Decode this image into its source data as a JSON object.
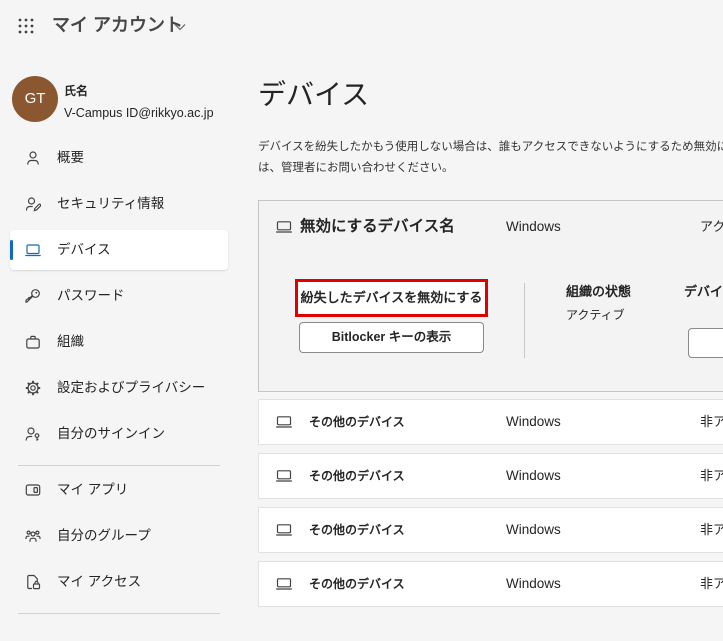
{
  "header": {
    "waffle_icon": "waffle-icon",
    "app_title": "マイ アカウント",
    "dropdown_icon": "chevron-down-icon"
  },
  "profile": {
    "initials": "GT",
    "name": "氏名",
    "account": "V-Campus ID@rikkyo.ac.jp"
  },
  "sidebar": {
    "items": [
      {
        "label": "概要",
        "icon": "person-icon",
        "selected": false
      },
      {
        "label": "セキュリティ情報",
        "icon": "person-edit-icon",
        "selected": false
      },
      {
        "label": "デバイス",
        "icon": "laptop-icon",
        "selected": true
      },
      {
        "label": "パスワード",
        "icon": "key-icon",
        "selected": false
      },
      {
        "label": "組織",
        "icon": "briefcase-icon",
        "selected": false
      },
      {
        "label": "設定およびプライバシー",
        "icon": "gear-icon",
        "selected": false
      },
      {
        "label": "自分のサインイン",
        "icon": "person-key-icon",
        "selected": false
      },
      {
        "label": "マイ アプリ",
        "icon": "apps-icon",
        "selected": false
      },
      {
        "label": "自分のグループ",
        "icon": "people-icon",
        "selected": false
      },
      {
        "label": "マイ アクセス",
        "icon": "document-lock-icon",
        "selected": false
      }
    ]
  },
  "main": {
    "title": "デバイス",
    "description": [
      "デバイスを紛失したかもう使用しない場合は、誰もアクセスできないようにするため無効に",
      "は、管理者にお問い合わせください。"
    ],
    "expanded_device": {
      "icon": "laptop-icon",
      "name": "無効にするデバイス名",
      "os": "Windows",
      "status": "アク",
      "disable_button": "紛失したデバイスを無効にする",
      "bitlocker_button": "Bitlocker キーの表示",
      "org_status_label": "組織の状態",
      "org_status_value": "アクティブ",
      "device_column_label": "デバイス"
    },
    "other_devices": [
      {
        "name": "その他のデバイス",
        "os": "Windows",
        "status": "非ア"
      },
      {
        "name": "その他のデバイス",
        "os": "Windows",
        "status": "非ア"
      },
      {
        "name": "その他のデバイス",
        "os": "Windows",
        "status": "非ア"
      },
      {
        "name": "その他のデバイス",
        "os": "Windows",
        "status": "非ア"
      }
    ]
  },
  "colors": {
    "accent": "#0f6cbd",
    "avatar": "#8a5731",
    "highlight_border": "#e00000"
  }
}
